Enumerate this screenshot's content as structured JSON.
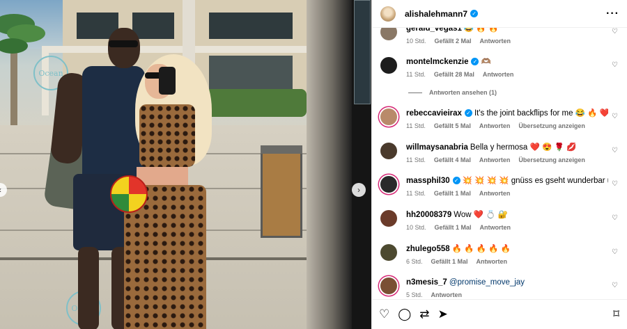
{
  "post": {
    "author": "alishalehmann7",
    "verified": true,
    "more_icon": "more-horizontal-icon",
    "watermark": "Ocean"
  },
  "comments": [
    {
      "username": "gerald_vegas1",
      "verified": false,
      "text": "😂 🔥 🔥",
      "time": "10 Std.",
      "likes": "Gefällt 2 Mal",
      "reply": "Antworten",
      "translate": ""
    },
    {
      "username": "montelmckenzie",
      "verified": true,
      "text": "🫶🏽",
      "time": "11 Std.",
      "likes": "Gefällt 28 Mal",
      "reply": "Antworten",
      "translate": ""
    },
    {
      "username": "rebeccavieirax",
      "verified": true,
      "text": "It's the joint backflips for me 😂 🔥 ❤️",
      "time": "11 Std.",
      "likes": "Gefällt 5 Mal",
      "reply": "Antworten",
      "translate": "Übersetzung anzeigen"
    },
    {
      "username": "willmaysanabria",
      "verified": false,
      "text": "Bella y hermosa ❤️ 😍 🌹 💋",
      "time": "11 Std.",
      "likes": "Gefällt 4 Mal",
      "reply": "Antworten",
      "translate": "Übersetzung anzeigen"
    },
    {
      "username": "massphil30",
      "verified": true,
      "text": "💥 💥 💥 💥 gnüss es gseht wunderbar us",
      "time": "11 Std.",
      "likes": "Gefällt 1 Mal",
      "reply": "Antworten",
      "translate": ""
    },
    {
      "username": "hh20008379",
      "verified": false,
      "text": "Wow ❤️ 💍 🔐",
      "time": "10 Std.",
      "likes": "Gefällt 1 Mal",
      "reply": "Antworten",
      "translate": ""
    },
    {
      "username": "zhulego558",
      "verified": false,
      "text": "🔥 🔥 🔥 🔥 🔥",
      "time": "6 Std.",
      "likes": "Gefällt 1 Mal",
      "reply": "Antworten",
      "translate": ""
    },
    {
      "username": "n3mesis_7",
      "verified": false,
      "text": "",
      "mention": "@promise_move_jay",
      "time": "5 Std.",
      "likes": "",
      "reply": "Antworten",
      "translate": ""
    }
  ],
  "view_replies": "Antworten ansehen (1)",
  "actions": {
    "like": "♡",
    "comment": "◯",
    "repost": "⇄",
    "share": "➤",
    "save": "⌑"
  },
  "nav": {
    "prev": "‹",
    "next": "›"
  },
  "colors": {
    "verified": "#0095f6",
    "link": "#00376b",
    "meta": "#737373"
  }
}
